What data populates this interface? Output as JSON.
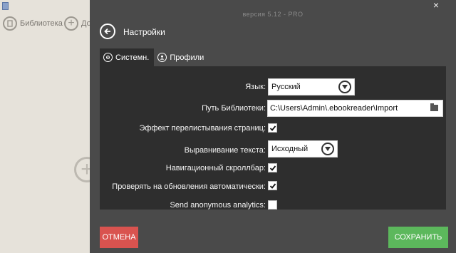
{
  "background": {
    "nav": [
      {
        "label": "Библиотека",
        "icon": "book-icon"
      },
      {
        "label": "До",
        "icon": "plus-icon"
      }
    ]
  },
  "header": {
    "version": "версия 5.12 - PRO",
    "title": "Настройки",
    "close": "×"
  },
  "tabs": [
    {
      "label": "Системн.",
      "icon": "gear-icon",
      "active": true
    },
    {
      "label": "Профили",
      "icon": "user-icon",
      "active": false
    }
  ],
  "settings": {
    "language": {
      "label": "Язык:",
      "value": "Русский"
    },
    "library_path": {
      "label": "Путь Библиотеки:",
      "value": "C:\\Users\\Admin\\.ebookreader\\Import"
    },
    "page_turn": {
      "label": "Эффект перелистывания страниц:",
      "checked": true
    },
    "alignment": {
      "label": "Выравнивание текста:",
      "value": "Исходный"
    },
    "scrollbar": {
      "label": "Навигационный скроллбар:",
      "checked": true
    },
    "auto_update": {
      "label": "Проверять на обновления автоматически:",
      "checked": true
    },
    "analytics": {
      "label": "Send anonymous analytics:",
      "checked": false
    }
  },
  "footer": {
    "cancel": "ОТМЕНА",
    "save": "СОХРАНИТЬ"
  },
  "colors": {
    "panel": "#4a4a4a",
    "content": "#2e2e2e",
    "cancel": "#d9534f",
    "save": "#5cb85c"
  }
}
